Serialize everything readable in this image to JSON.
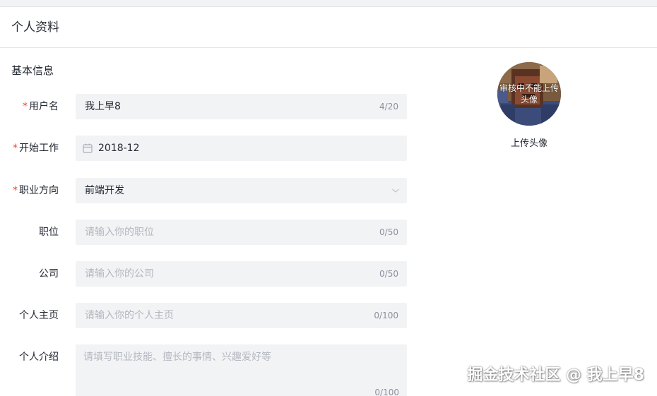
{
  "page": {
    "title": "个人资料"
  },
  "section": {
    "title": "基本信息"
  },
  "form": {
    "username": {
      "label": "用户名",
      "required": true,
      "value": "我上早8",
      "counter": "4/20"
    },
    "start_work": {
      "label": "开始工作",
      "required": true,
      "value": "2018-12",
      "icon": "calendar-icon"
    },
    "career": {
      "label": "职业方向",
      "required": true,
      "value": "前端开发",
      "icon": "chevron-down-icon"
    },
    "position": {
      "label": "职位",
      "required": false,
      "placeholder": "请输入你的职位",
      "counter": "0/50"
    },
    "company": {
      "label": "公司",
      "required": false,
      "placeholder": "请输入你的公司",
      "counter": "0/50"
    },
    "homepage": {
      "label": "个人主页",
      "required": false,
      "placeholder": "请输入你的个人主页",
      "counter": "0/100"
    },
    "intro": {
      "label": "个人介绍",
      "required": false,
      "placeholder": "请填写职业技能、擅长的事情、兴趣爱好等",
      "counter": "0/100"
    }
  },
  "avatar": {
    "overlay_text": "审核中不能上传头像",
    "upload_label": "上传头像"
  },
  "watermark": {
    "text": "掘金技术社区 @ 我上早8"
  },
  "colors": {
    "required_mark": "#f53f3f",
    "field_bg": "#f2f3f5",
    "placeholder": "#b3b7bf",
    "counter": "#8a919f"
  }
}
